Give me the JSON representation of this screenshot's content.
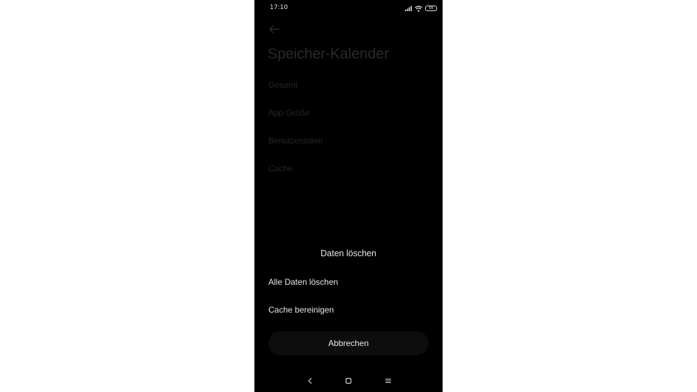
{
  "status_bar": {
    "time": "17:10",
    "battery": "66",
    "icons": [
      "signal-icon",
      "wifi-icon",
      "battery-icon"
    ]
  },
  "header": {
    "back_icon": "arrow-left-icon",
    "title": "Speicher-Kalender"
  },
  "storage_info": {
    "rows": [
      {
        "label": "Gesamt"
      },
      {
        "label": "App-Größe"
      },
      {
        "label": "Benutzerdaten"
      },
      {
        "label": "Cache"
      }
    ]
  },
  "dialog": {
    "title": "Daten löschen",
    "options": [
      {
        "label": "Alle Daten löschen"
      },
      {
        "label": "Cache bereinigen"
      }
    ],
    "cancel_label": "Abbrechen"
  },
  "nav_bar": {
    "icons": [
      "nav-back-icon",
      "nav-home-icon",
      "nav-menu-icon"
    ]
  },
  "colors": {
    "screen_bg": "#000000",
    "page_bg": "#ffffff",
    "dim_text": "#262626",
    "dialog_text": "#e8e8e8"
  }
}
